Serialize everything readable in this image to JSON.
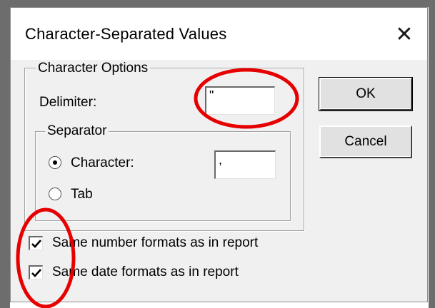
{
  "window": {
    "title": "Character-Separated Values",
    "close_symbol": "✕"
  },
  "character_options": {
    "legend": "Character Options",
    "delimiter_label": "Delimiter:",
    "delimiter_value": "\""
  },
  "separator": {
    "legend": "Separator",
    "character_label": "Character:",
    "character_value": ",",
    "tab_label": "Tab",
    "selected": "Character"
  },
  "buttons": {
    "ok": "OK",
    "cancel": "Cancel"
  },
  "checkboxes": {
    "number_formats": {
      "label": "Same number formats as in report",
      "checked": true
    },
    "date_formats": {
      "label": "Same date formats as in report",
      "checked": true
    }
  },
  "colors": {
    "annotation": "#e60000",
    "dialog_bg": "#f0f0f0"
  }
}
